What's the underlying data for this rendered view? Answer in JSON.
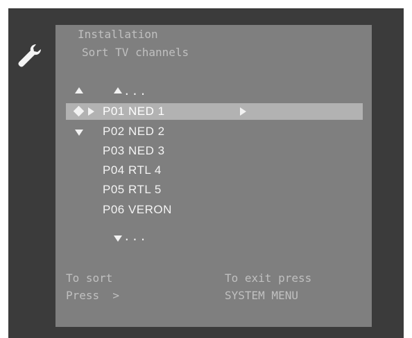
{
  "menu": {
    "breadcrumb_level1": "Installation",
    "breadcrumb_level2": "Sort TV channels"
  },
  "icons": {
    "settings": "wrench-icon",
    "scroll_up": "triangle-up-icon",
    "scroll_down": "triangle-down-icon",
    "navigate": "diamond-icon",
    "select": "triangle-right-icon"
  },
  "list": {
    "more_above": "...",
    "more_below": "...",
    "channels": [
      {
        "label": "P01 NED 1",
        "selected": true
      },
      {
        "label": "P02 NED 2",
        "selected": false
      },
      {
        "label": "P03 NED 3",
        "selected": false
      },
      {
        "label": "P04 RTL 4",
        "selected": false
      },
      {
        "label": "P05 RTL 5",
        "selected": false
      },
      {
        "label": "P06 VERON",
        "selected": false
      }
    ]
  },
  "footer": {
    "sort_line1": "To sort",
    "sort_line2": "Press  >",
    "exit_line1": "To exit press",
    "exit_line2": "SYSTEM MENU"
  },
  "colors": {
    "frame": "#3b3b3b",
    "panel": "#7f7f7f",
    "highlight": "#b2b2b2",
    "text": "#f4f4f4"
  }
}
